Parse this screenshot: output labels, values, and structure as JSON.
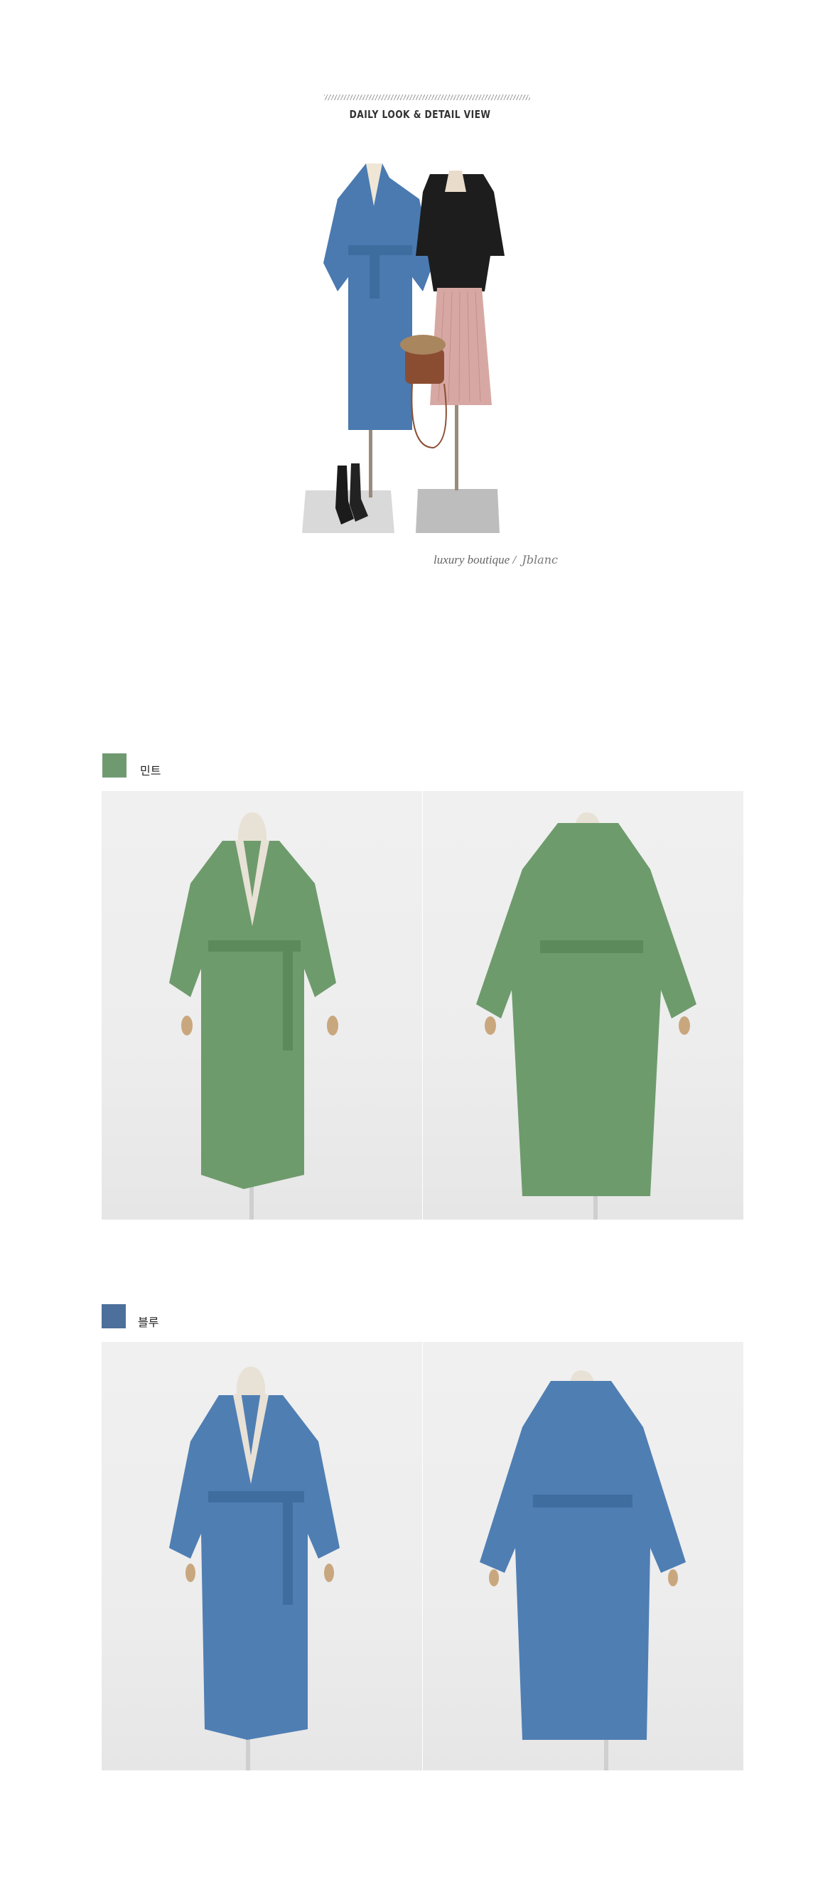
{
  "header": {
    "title": "DAILY LOOK & DETAIL VIEW"
  },
  "signature": {
    "text": "luxury boutique",
    "separator": "/",
    "script": "Jblanc"
  },
  "colors": [
    {
      "name": "민트",
      "hex": "#6f9a70",
      "coat": "#6e9b6c",
      "shade": "#5c8a5b"
    },
    {
      "name": "블루",
      "hex": "#4d6f9b",
      "coat": "#4f7eb3",
      "shade": "#3f6d9f"
    }
  ],
  "hero_colors": {
    "blue_coat": "#4a7ab0",
    "fur_jacket": "#1d1d1d",
    "skirt": "#d7a8a3"
  }
}
